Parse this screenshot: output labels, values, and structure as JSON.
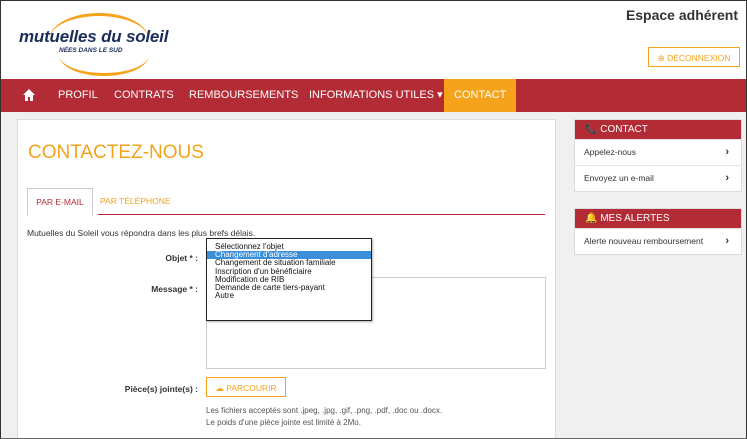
{
  "header": {
    "logo_name": "mutuelles du soleil",
    "logo_tagline": "NÉES DANS LE SUD",
    "espace_title": "Espace adhérent",
    "logout_label": "⊕ DÉCONNEXION"
  },
  "nav": {
    "home_icon": "home-icon",
    "items": [
      "PROFIL",
      "CONTRATS",
      "REMBOURSEMENTS",
      "INFORMATIONS UTILES ▾",
      "CONTACT"
    ],
    "active": "CONTACT"
  },
  "main": {
    "title": "CONTACTEZ-NOUS",
    "tabs": [
      "PAR E-MAIL",
      "PAR TÉLÉPHONE"
    ],
    "intro": "Mutuelles du Soleil vous répondra dans les plus brefs délais.",
    "labels": {
      "objet": "Objet * :",
      "message": "Message * :",
      "pieces": "Pièce(s) jointe(s) :"
    },
    "objet_options": [
      "Sélectionnez l'objet",
      "Changement d'adresse",
      "Changement de situation familiale",
      "Inscription d'un bénéficiaire",
      "Modification de RIB",
      "Demande de carte tiers-payant",
      "Autre"
    ],
    "objet_highlighted": "Changement d'adresse",
    "browse_label": "☁ PARCOURIR",
    "hint_formats": "Les fichiers acceptés sont .jpeg, .jpg, .gif, .png, .pdf, .doc ou .docx.",
    "hint_size": "Le poids d'une pièce jointe est limité à 2Mo."
  },
  "sidebar": {
    "contact": {
      "title": "📞 CONTACT",
      "items": [
        "Appelez-nous",
        "Envoyez un e-mail"
      ]
    },
    "alertes": {
      "title": "🔔 MES ALERTES",
      "items": [
        "Alerte nouveau remboursement"
      ]
    },
    "chevron": "›"
  },
  "colors": {
    "brand_red": "#b22b35",
    "brand_orange": "#f5a31a",
    "logo_navy": "#1b2d5b",
    "highlight_blue": "#3b8fd9"
  }
}
